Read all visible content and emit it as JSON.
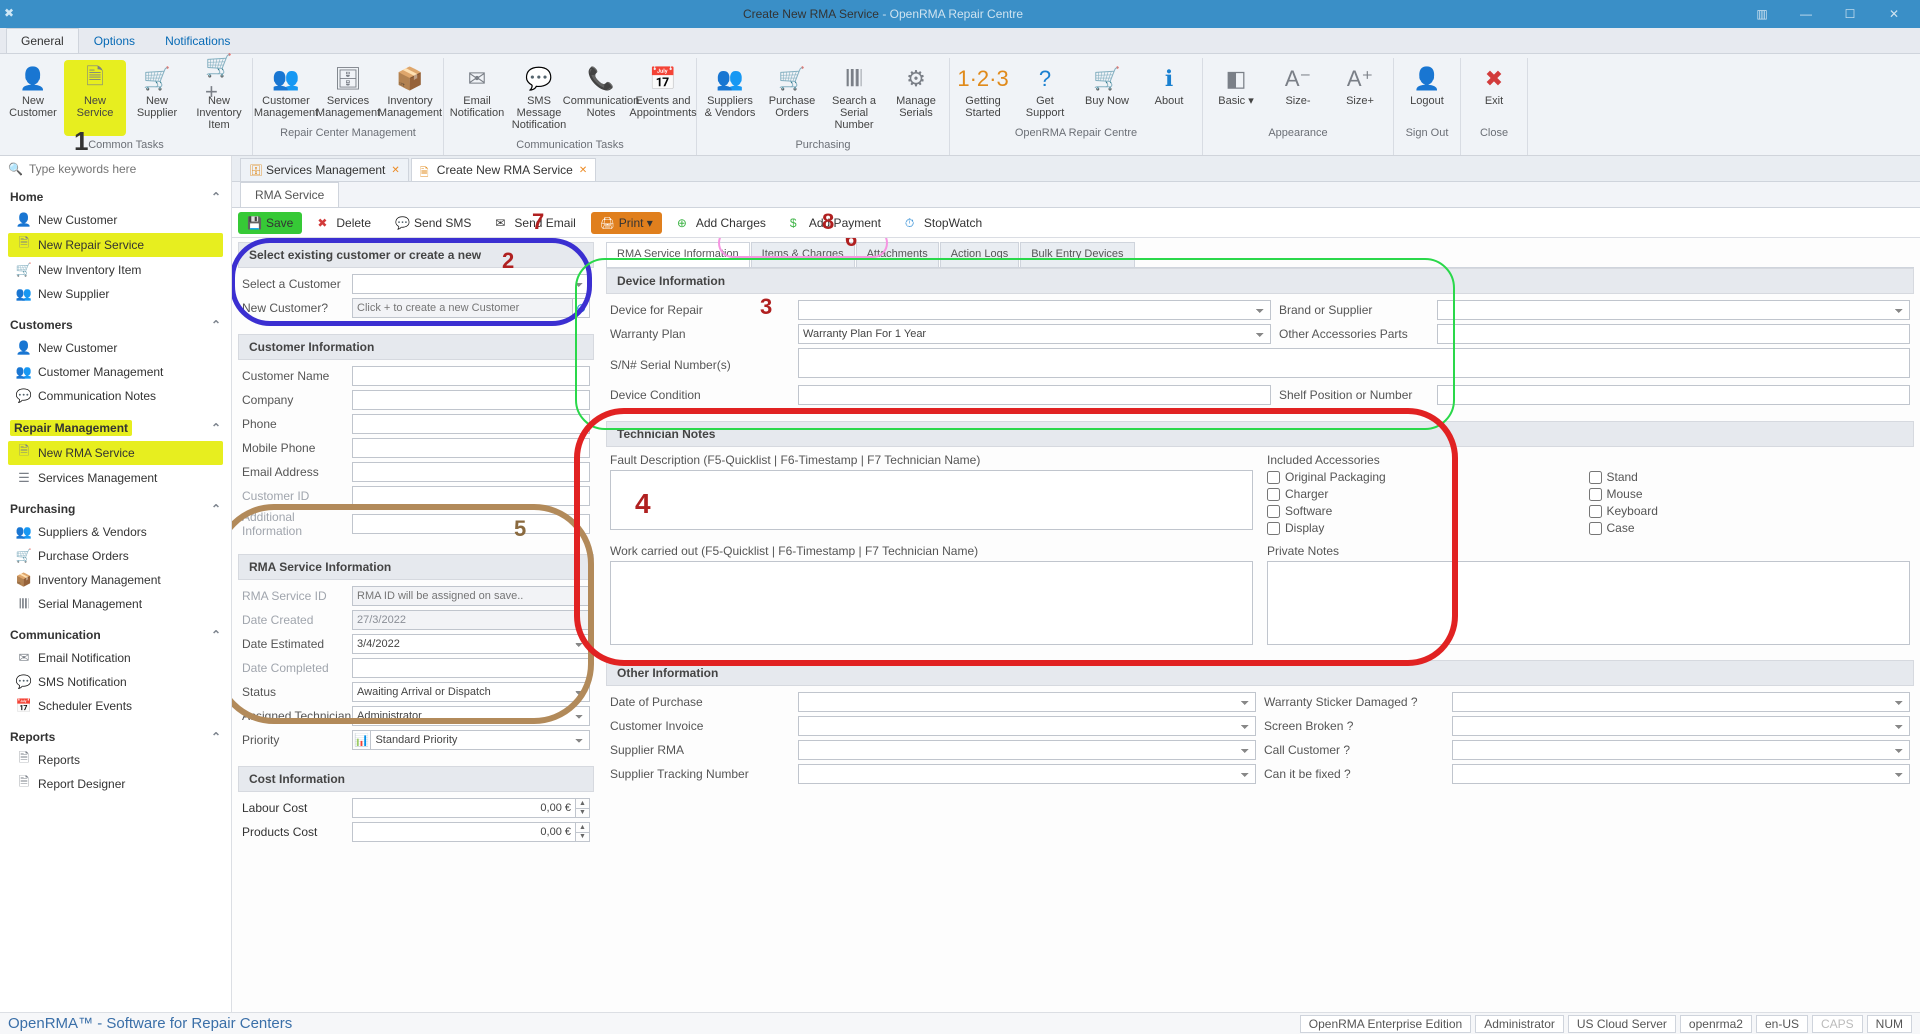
{
  "title": {
    "main": "Create New RMA Service",
    "sub": " - OpenRMA Repair Centre"
  },
  "menutabs": [
    "General",
    "Options",
    "Notifications"
  ],
  "ribbon": {
    "groups": [
      {
        "cap": "Common Tasks",
        "btns": [
          {
            "n": "new-customer",
            "t": "New Customer",
            "ic": "👤"
          },
          {
            "n": "new-service",
            "t": "New Service",
            "ic": "🗎",
            "hl": true
          },
          {
            "n": "new-supplier",
            "t": "New Supplier",
            "ic": "🛒"
          },
          {
            "n": "new-inventory-item",
            "t": "New Inventory Item",
            "ic": "🛒+"
          }
        ]
      },
      {
        "cap": "Repair Center Management",
        "btns": [
          {
            "n": "customer-management",
            "t": "Customer Management",
            "ic": "👥"
          },
          {
            "n": "services-management",
            "t": "Services Management",
            "ic": "🗄"
          },
          {
            "n": "inventory-management",
            "t": "Inventory Management",
            "ic": "📦"
          }
        ]
      },
      {
        "cap": "Communication Tasks",
        "btns": [
          {
            "n": "email-notification",
            "t": "Email Notification",
            "ic": "✉"
          },
          {
            "n": "sms-message",
            "t": "SMS Message Notification",
            "ic": "💬"
          },
          {
            "n": "communication-notes",
            "t": "Communication Notes",
            "ic": "📞"
          },
          {
            "n": "events-appointments",
            "t": "Events and Appointments",
            "ic": "📅"
          }
        ]
      },
      {
        "cap": "Purchasing",
        "btns": [
          {
            "n": "suppliers-vendors",
            "t": "Suppliers & Vendors",
            "ic": "👥"
          },
          {
            "n": "purchase-orders",
            "t": "Purchase Orders",
            "ic": "🛒"
          },
          {
            "n": "search-serial",
            "t": "Search a Serial Number",
            "ic": "𝄃𝄃𝄃"
          },
          {
            "n": "manage-serials",
            "t": "Manage Serials",
            "ic": "⚙"
          }
        ]
      },
      {
        "cap": "OpenRMA Repair Centre",
        "btns": [
          {
            "n": "getting-started",
            "t": "Getting Started",
            "ic": "1·2·3",
            "cls": "orange"
          },
          {
            "n": "get-support",
            "t": "Get Support",
            "ic": "?",
            "cls": "blue"
          },
          {
            "n": "buy-now",
            "t": "Buy Now",
            "ic": "🛒",
            "cls": "green"
          },
          {
            "n": "about",
            "t": "About",
            "ic": "ℹ",
            "cls": "blue"
          }
        ]
      },
      {
        "cap": "Appearance",
        "btns": [
          {
            "n": "basic-theme",
            "t": "Basic ▾",
            "ic": "◧"
          },
          {
            "n": "size-minus",
            "t": "Size-",
            "ic": "A⁻"
          },
          {
            "n": "size-plus",
            "t": "Size+",
            "ic": "A⁺"
          }
        ]
      },
      {
        "cap": "Sign Out",
        "btns": [
          {
            "n": "logout",
            "t": "Logout",
            "ic": "👤"
          }
        ]
      },
      {
        "cap": "Close",
        "btns": [
          {
            "n": "exit",
            "t": "Exit",
            "ic": "✖",
            "cls": "red"
          }
        ]
      }
    ]
  },
  "side": {
    "search_ph": "Type keywords here",
    "sections": [
      {
        "h": "Home",
        "items": [
          {
            "t": "New Customer",
            "ic": "👤"
          },
          {
            "t": "New Repair Service",
            "ic": "🗎",
            "hl": true
          },
          {
            "t": "New Inventory Item",
            "ic": "🛒"
          },
          {
            "t": "New Supplier",
            "ic": "👥"
          }
        ]
      },
      {
        "h": "Customers",
        "items": [
          {
            "t": "New Customer",
            "ic": "👤"
          },
          {
            "t": "Customer Management",
            "ic": "👥"
          },
          {
            "t": "Communication Notes",
            "ic": "💬"
          }
        ]
      },
      {
        "h": "Repair Management",
        "hl": true,
        "items": [
          {
            "t": "New RMA Service",
            "ic": "🗎",
            "hl": true
          },
          {
            "t": "Services Management",
            "ic": "☰"
          }
        ]
      },
      {
        "h": "Purchasing",
        "items": [
          {
            "t": "Suppliers & Vendors",
            "ic": "👥"
          },
          {
            "t": "Purchase Orders",
            "ic": "🛒"
          },
          {
            "t": "Inventory Management",
            "ic": "📦"
          },
          {
            "t": "Serial Management",
            "ic": "𝄃𝄃𝄃"
          }
        ]
      },
      {
        "h": "Communication",
        "items": [
          {
            "t": "Email Notification",
            "ic": "✉"
          },
          {
            "t": "SMS Notification",
            "ic": "💬"
          },
          {
            "t": "Scheduler Events",
            "ic": "📅"
          }
        ]
      },
      {
        "h": "Reports",
        "items": [
          {
            "t": "Reports",
            "ic": "🗎"
          },
          {
            "t": "Report Designer",
            "ic": "🗎"
          }
        ]
      }
    ]
  },
  "doctabs": [
    {
      "t": "Services Management",
      "ic": "🗄"
    },
    {
      "t": "Create New RMA Service",
      "ic": "🗎",
      "active": true
    }
  ],
  "subtab": "RMA Service",
  "toolbar": [
    {
      "n": "save",
      "t": "Save",
      "ic": "💾",
      "cls": "save"
    },
    {
      "n": "delete",
      "t": "Delete",
      "ic": "✖",
      "iccol": "#d23b3b"
    },
    {
      "n": "send-sms",
      "t": "Send SMS",
      "ic": "💬"
    },
    {
      "n": "send-email",
      "t": "Send Email",
      "ic": "✉"
    },
    {
      "n": "print",
      "t": "Print ▾",
      "ic": "🖨",
      "cls": "print"
    },
    {
      "n": "add-charges",
      "t": "Add Charges",
      "ic": "⊕",
      "iccol": "#3fb447"
    },
    {
      "n": "add-payment",
      "t": "Add Payment",
      "ic": "$",
      "iccol": "#3fb447"
    },
    {
      "n": "stopwatch",
      "t": "StopWatch",
      "ic": "⏱",
      "iccol": "#1a80d0"
    }
  ],
  "left": {
    "sel_hdr": "Select existing customer or create a new",
    "sel_customer_lbl": "Select a Customer",
    "new_customer_lbl": "New Customer?",
    "new_customer_ph": "Click + to create a new Customer",
    "ci_hdr": "Customer Information",
    "ci": [
      {
        "l": "Customer Name"
      },
      {
        "l": "Company"
      },
      {
        "l": "Phone"
      },
      {
        "l": "Mobile Phone"
      },
      {
        "l": "Email Address"
      },
      {
        "l": "Customer ID",
        "mut": true
      },
      {
        "l": "Additional Information",
        "mut": true
      }
    ],
    "rsi_hdr": "RMA Service Information",
    "rsi": {
      "id_lbl": "RMA Service ID",
      "id_ph": "RMA ID will be assigned on save..",
      "created_lbl": "Date Created",
      "created": "27/3/2022",
      "est_lbl": "Date Estimated",
      "est": "3/4/2022",
      "comp_lbl": "Date Completed",
      "status_lbl": "Status",
      "status": "Awaiting Arrival or Dispatch",
      "tech_lbl": "Assigned Technician",
      "tech": "Administrator",
      "prio_lbl": "Priority",
      "prio": "Standard Priority"
    },
    "cost_hdr": "Cost Information",
    "cost": {
      "labour_lbl": "Labour Cost",
      "labour": "0,00 €",
      "prod_lbl": "Products Cost",
      "prod": "0,00 €"
    }
  },
  "righttabs": [
    "RMA Service Information",
    "Items & Charges",
    "Attachments",
    "Action Logs",
    "Bulk Entry Devices"
  ],
  "dev": {
    "hdr": "Device Information",
    "dev_lbl": "Device for Repair",
    "brand_lbl": "Brand or Supplier",
    "war_lbl": "Warranty Plan",
    "war": "Warranty Plan For 1 Year",
    "acc_lbl": "Other Accessories Parts",
    "sn_lbl": "S/N# Serial Number(s)",
    "cond_lbl": "Device Condition",
    "shelf_lbl": "Shelf Position or Number"
  },
  "tech": {
    "hdr": "Technician Notes",
    "fault_lbl": "Fault Description (F5-Quicklist | F6-Timestamp | F7 Technician Name)",
    "inc_lbl": "Included Accessories",
    "inc": [
      "Original Packaging",
      "Stand",
      "Charger",
      "Mouse",
      "Software",
      "Keyboard",
      "Display",
      "Case"
    ],
    "work_lbl": "Work carried out (F5-Quicklist | F6-Timestamp | F7 Technician Name)",
    "priv_lbl": "Private Notes"
  },
  "other": {
    "hdr": "Other Information",
    "rows": [
      [
        "Date of Purchase",
        "Warranty Sticker Damaged ?"
      ],
      [
        "Customer Invoice",
        "Screen Broken ?"
      ],
      [
        "Supplier RMA",
        "Call Customer ?"
      ],
      [
        "Supplier Tracking Number",
        "Can it be fixed ?"
      ]
    ]
  },
  "annots": {
    "1": "1",
    "2": "2",
    "3": "3",
    "4": "4",
    "5": "5",
    "6": "6",
    "7": "7",
    "8": "8"
  },
  "status": {
    "brand": "OpenRMA™ - Software for Repair Centers",
    "chips": [
      "OpenRMA Enterprise Edition",
      "Administrator",
      "US Cloud Server",
      "openrma2",
      "en-US",
      "CAPS",
      "NUM"
    ]
  }
}
